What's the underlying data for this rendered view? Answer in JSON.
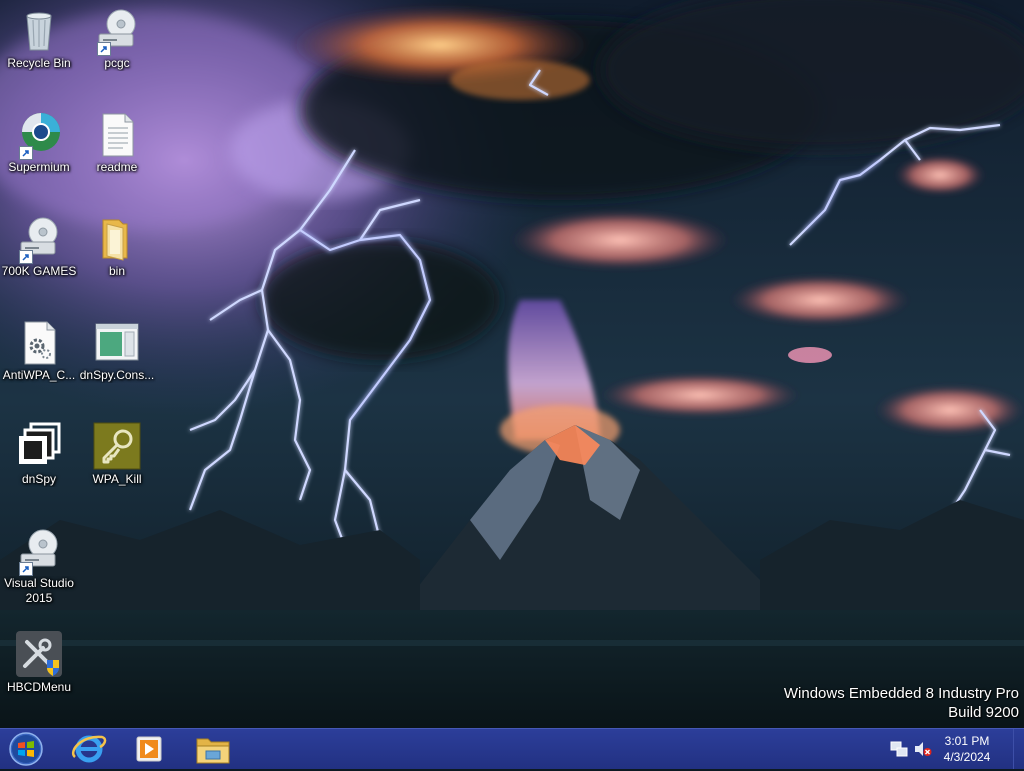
{
  "desktop": {
    "icons": [
      {
        "label": "Recycle Bin",
        "icon": "recycle-bin-icon"
      },
      {
        "label": "pcgc",
        "icon": "optical-drive-icon",
        "shortcut": true
      },
      {
        "label": "Supermium",
        "icon": "supermium-browser-icon",
        "shortcut": true
      },
      {
        "label": "readme",
        "icon": "text-file-icon"
      },
      {
        "label": "700K GAMES",
        "icon": "optical-drive-icon",
        "shortcut": true
      },
      {
        "label": "bin",
        "icon": "folder-icon"
      },
      {
        "label": "AntiWPA_C...",
        "icon": "config-file-icon"
      },
      {
        "label": "dnSpy.Cons...",
        "icon": "app-window-icon"
      },
      {
        "label": "dnSpy",
        "icon": "dnspy-icon"
      },
      {
        "label": "WPA_Kill",
        "icon": "key-icon"
      },
      {
        "label": "Visual Studio 2015",
        "icon": "optical-drive-icon",
        "shortcut": true
      },
      {
        "label": "HBCDMenu",
        "icon": "tools-shield-icon"
      }
    ]
  },
  "watermark": {
    "line1": "Windows Embedded 8 Industry Pro",
    "line2": "Build 9200"
  },
  "taskbar": {
    "start": "windows-start-orb-icon",
    "apps": [
      {
        "name": "Internet Explorer",
        "icon": "internet-explorer-icon"
      },
      {
        "name": "Windows Media Player",
        "icon": "media-player-icon"
      },
      {
        "name": "File Explorer",
        "icon": "file-explorer-icon"
      }
    ],
    "tray": {
      "network_icon": "network-icon",
      "volume_icon": "volume-muted-icon",
      "time": "3:01 PM",
      "date": "4/3/2024"
    }
  },
  "colors": {
    "taskbar": "#2c3e9a",
    "caption_text": "#ffffff"
  }
}
